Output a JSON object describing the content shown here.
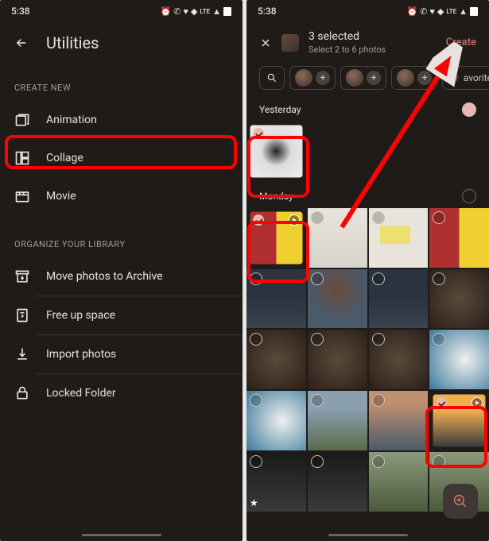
{
  "status": {
    "time": "5:38",
    "lte": "LTE"
  },
  "left": {
    "title": "Utilities",
    "sections": {
      "create": "CREATE NEW",
      "organize": "ORGANIZE YOUR LIBRARY"
    },
    "items": {
      "animation": "Animation",
      "collage": "Collage",
      "movie": "Movie",
      "archive": "Move photos to Archive",
      "freeup": "Free up space",
      "import": "Import photos",
      "locked": "Locked Folder"
    }
  },
  "right": {
    "selected": "3 selected",
    "subtitle": "Select 2 to 6 photos",
    "create": "Create",
    "favorites": "avorites",
    "dates": {
      "yesterday": "Yesterday",
      "monday": "Monday"
    }
  }
}
